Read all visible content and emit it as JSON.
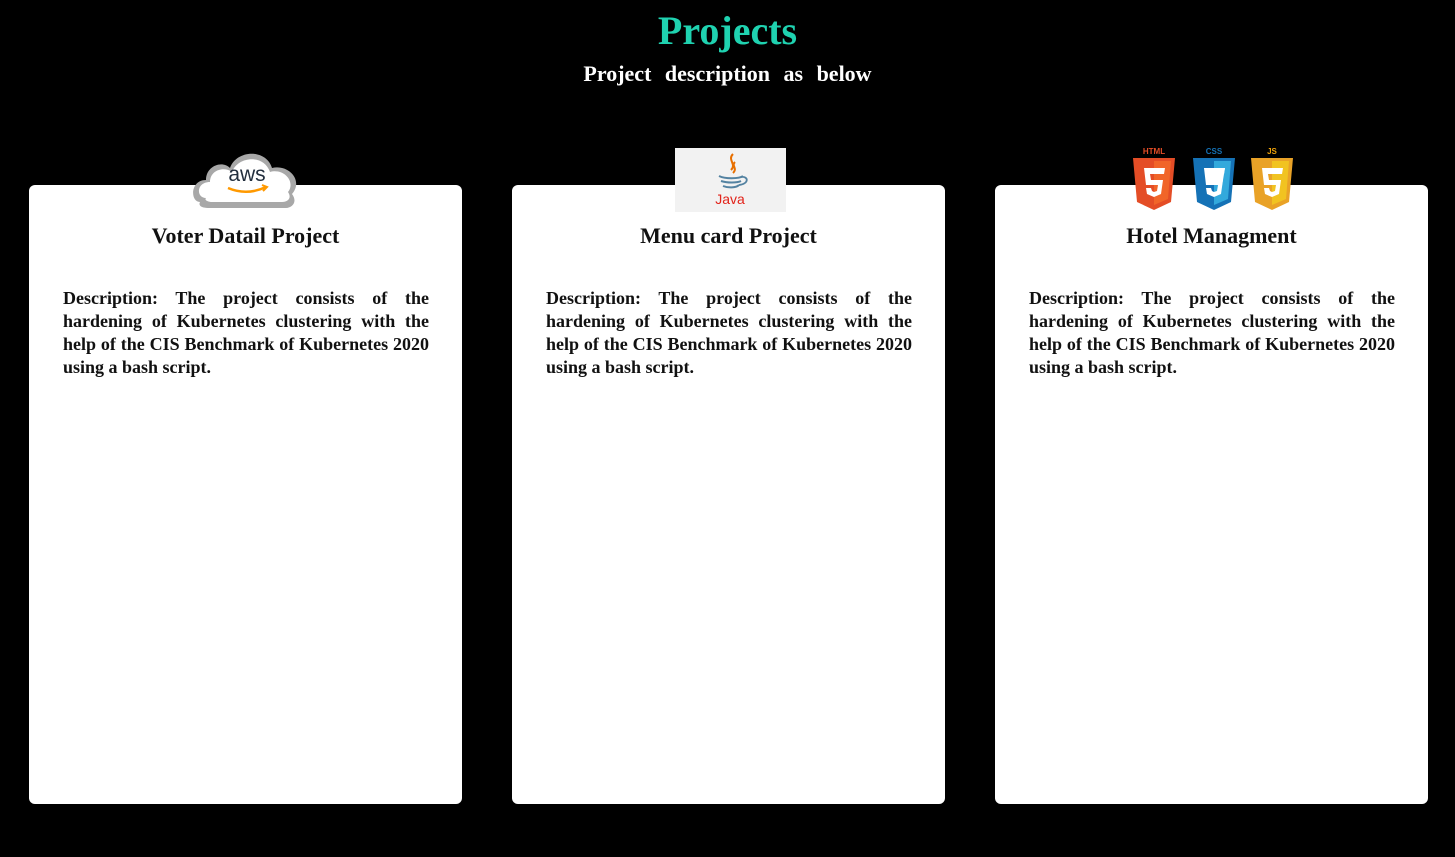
{
  "header": {
    "title": "Projects",
    "subtitle": "Project description as below",
    "title_color": "#1fd2b0"
  },
  "projects": [
    {
      "logo": "aws-logo",
      "logo_text": "aws",
      "title": "Voter Datail Project",
      "description": "Description: The project consists of the hardening of Kubernetes clustering with the help of the CIS Benchmark of Kubernetes 2020 using a bash script."
    },
    {
      "logo": "java-logo",
      "logo_text": "Java",
      "title": "Menu card Project",
      "description": "Description: The project consists of the hardening of Kubernetes clustering with the help of the CIS Benchmark of Kubernetes 2020 using a bash script."
    },
    {
      "logo": "html-css-js-logos",
      "logo_labels": [
        "HTML",
        "CSS",
        "JS"
      ],
      "title": "Hotel Managment",
      "description": "Description: The project consists of the hardening of Kubernetes clustering with the help of the CIS Benchmark of Kubernetes 2020 using a bash script."
    }
  ]
}
